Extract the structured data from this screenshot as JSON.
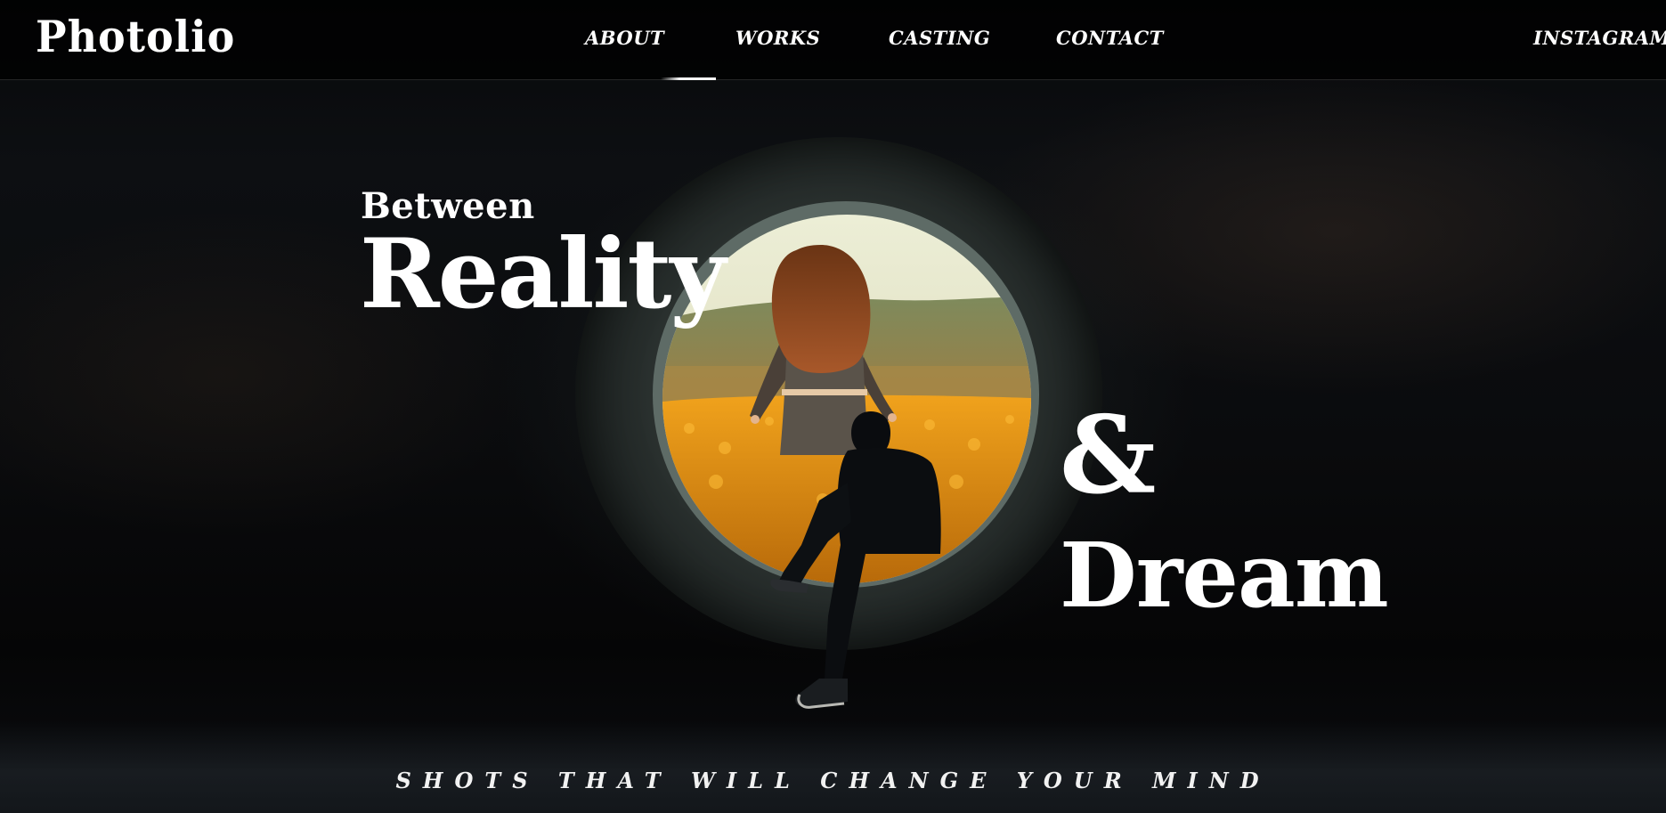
{
  "nav": {
    "logo": "Photolio",
    "links": [
      "ABOUT",
      "WORKS",
      "CASTING",
      "CONTACT"
    ],
    "instagram": "INSTAGRAM",
    "active_index": 1
  },
  "hero": {
    "line1": "Between",
    "line2": "Reality",
    "line3": "&",
    "line4": "Dream",
    "tagline": "SHOTS THAT WILL CHANGE YOUR MIND"
  },
  "colors": {
    "background": "#050506",
    "text": "#ffffff",
    "field": "#e8961a",
    "sky": "#e9e8cf"
  }
}
